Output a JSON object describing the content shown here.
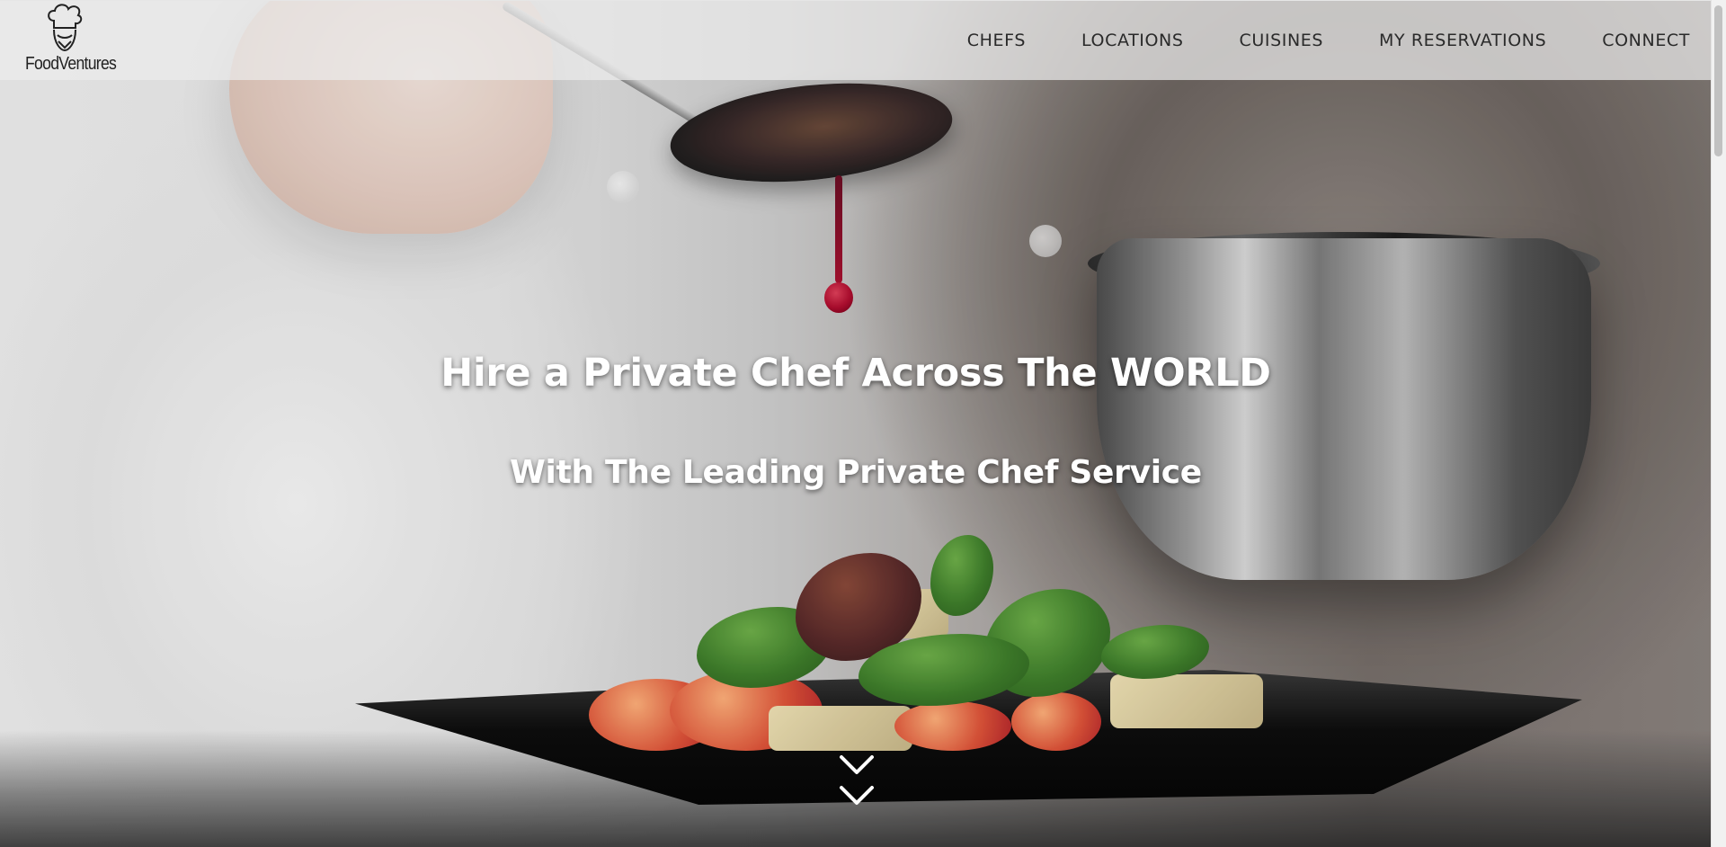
{
  "brand": {
    "name": "FoodVentures",
    "logo_icon": "chef-hat-icon"
  },
  "nav": {
    "items": [
      {
        "label": "CHEFS"
      },
      {
        "label": "LOCATIONS"
      },
      {
        "label": "CUISINES"
      },
      {
        "label": "MY RESERVATIONS"
      },
      {
        "label": "CONNECT"
      }
    ]
  },
  "hero": {
    "title": "Hire a Private Chef Across The WORLD",
    "subtitle": "With The Leading Private Chef Service",
    "scroll_icon": "chevron-down-icon"
  },
  "colors": {
    "nav_background": "#ebebeb",
    "heading_text": "#ffffff",
    "nav_text": "#2a2a2a"
  }
}
